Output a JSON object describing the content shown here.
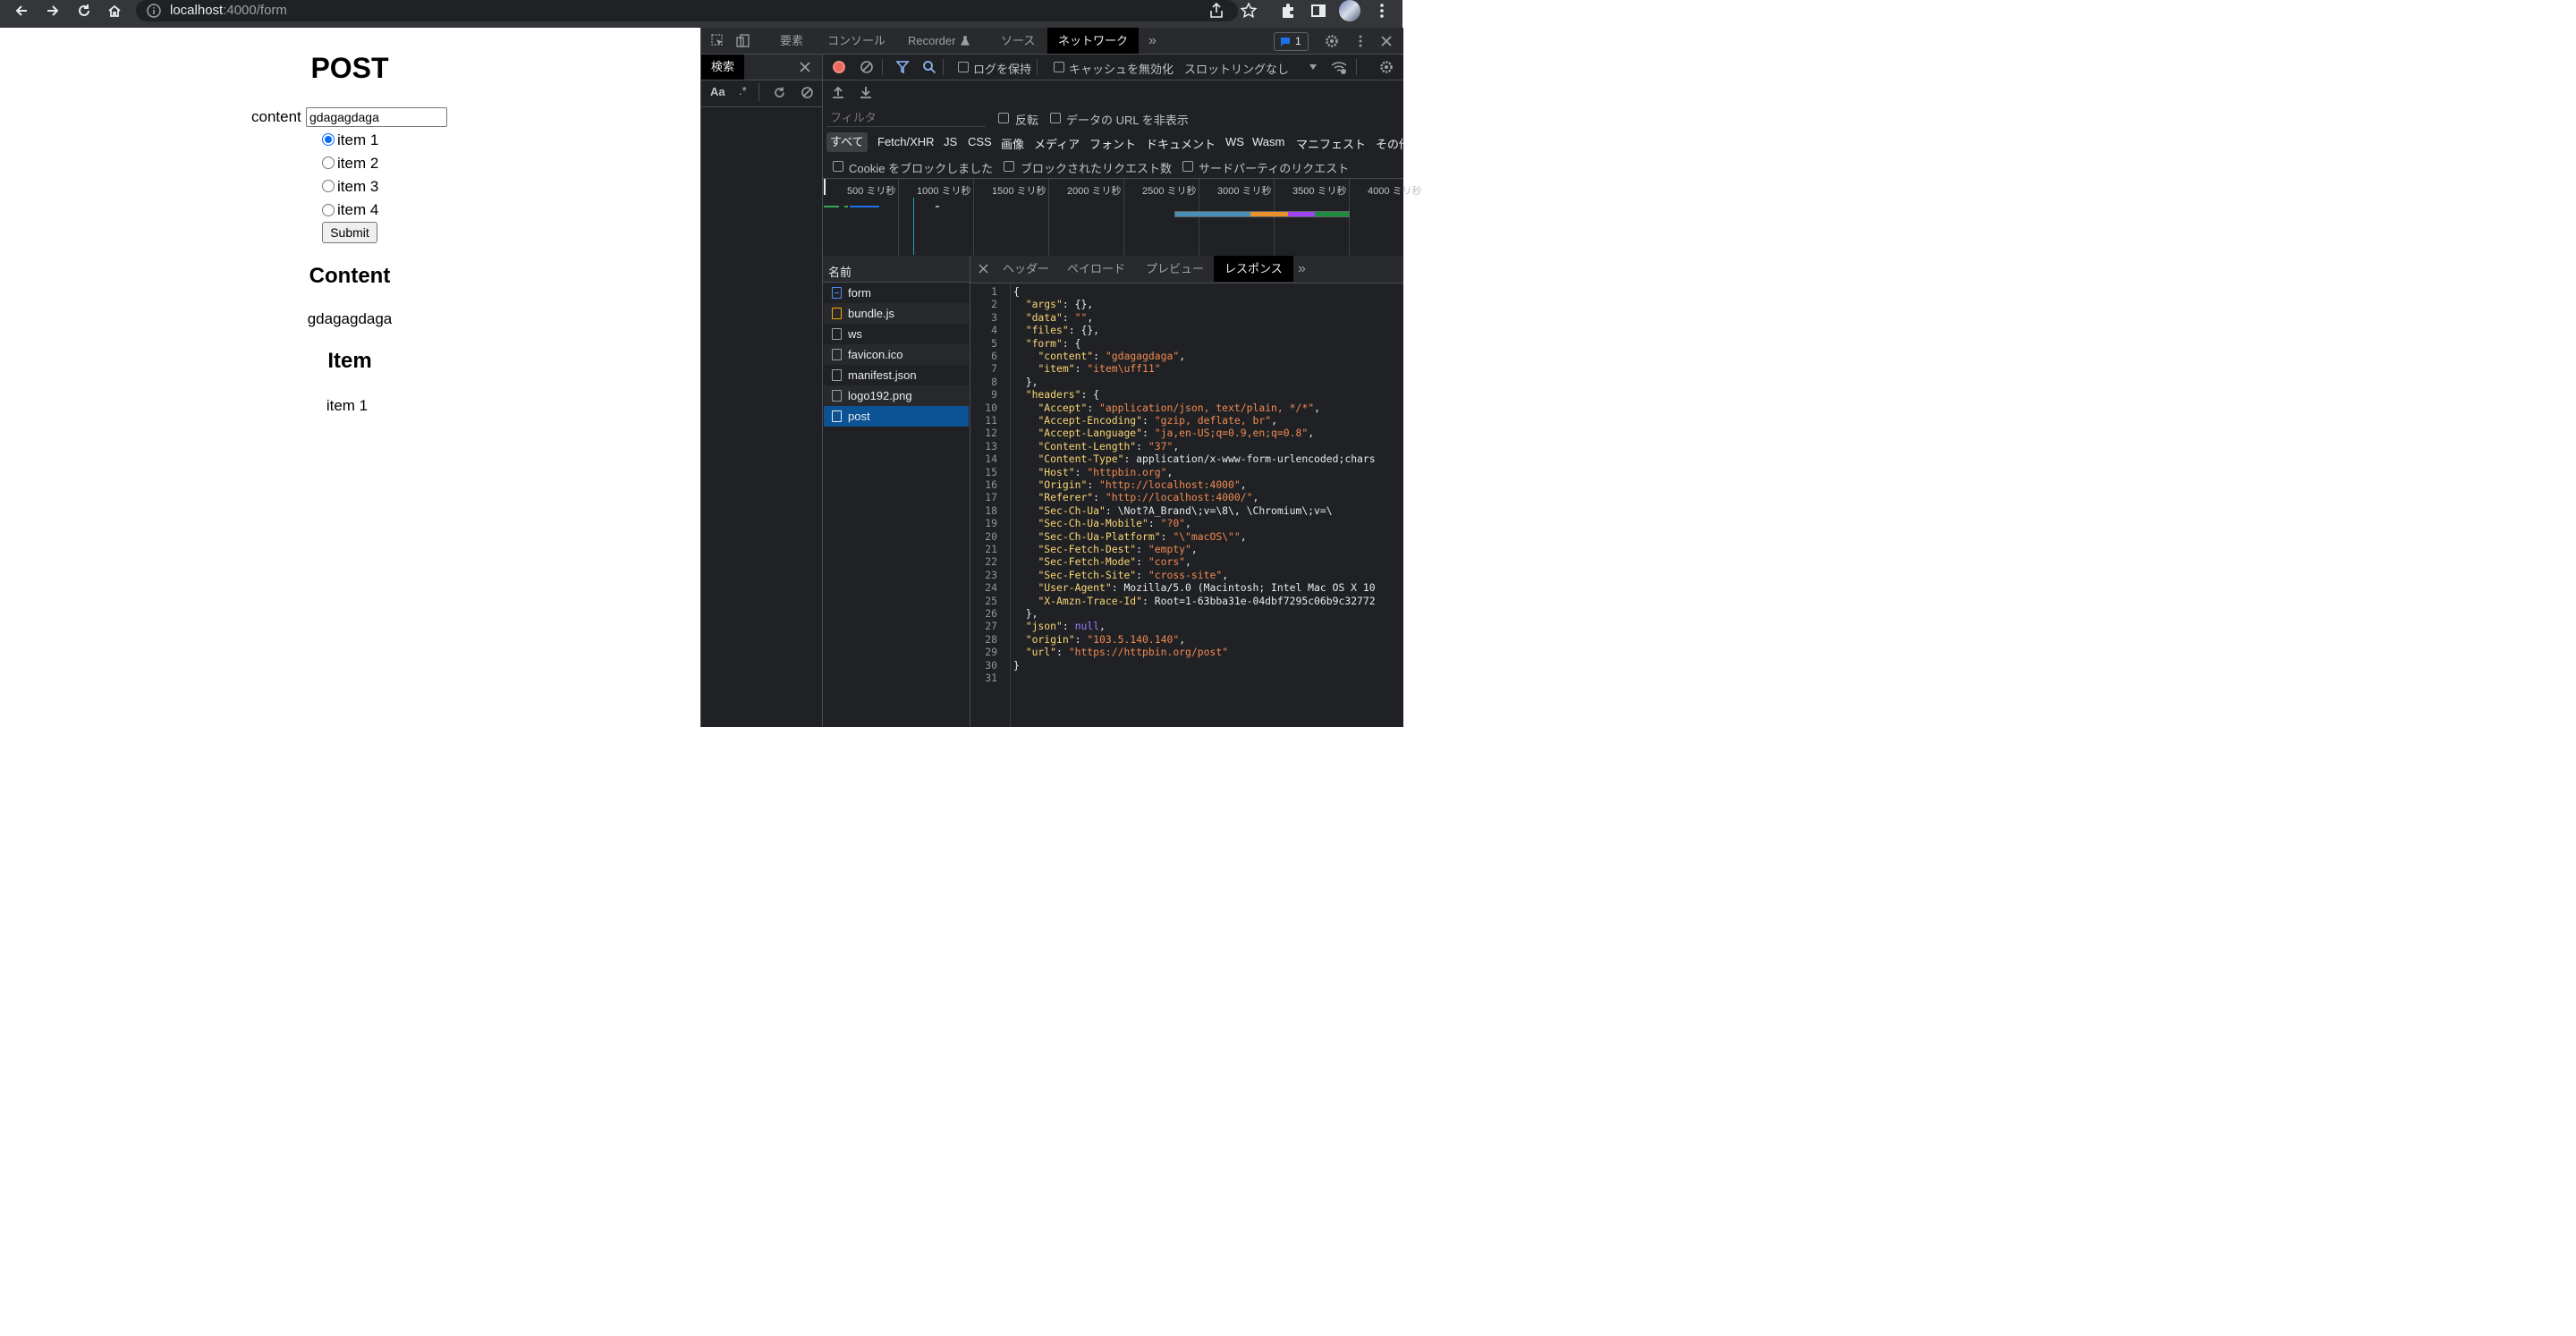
{
  "browser": {
    "url_host": "localhost",
    "url_path": ":4000/form"
  },
  "page": {
    "title": "POST",
    "content_label": "content",
    "content_value": "gdagagdaga",
    "radios": [
      {
        "label": "item 1",
        "checked": true
      },
      {
        "label": "item 2",
        "checked": false
      },
      {
        "label": "item 3",
        "checked": false
      },
      {
        "label": "item 4",
        "checked": false
      }
    ],
    "submit_label": "Submit",
    "content_heading": "Content",
    "content_text": "gdagagdaga",
    "item_heading": "Item",
    "item_text": "item 1"
  },
  "devtools": {
    "tabs": [
      "要素",
      "コンソール",
      "Recorder",
      "ソース",
      "ネットワーク"
    ],
    "active_tab": "ネットワーク",
    "issues_count": "1",
    "search_tab": "検索",
    "search_opts": [
      "Aa",
      ".*"
    ],
    "preserve_log": "ログを保持",
    "disable_cache": "キャッシュを無効化",
    "throttling": "スロットリングなし",
    "filter_placeholder": "フィルタ",
    "invert": "反転",
    "hide_data_urls": "データの URL を非表示",
    "types": [
      "すべて",
      "Fetch/XHR",
      "JS",
      "CSS",
      "画像",
      "メディア",
      "フォント",
      "ドキュメント",
      "WS",
      "Wasm",
      "マニフェスト",
      "その他"
    ],
    "blocked_cookies": "Cookie をブロックしました",
    "blocked_requests": "ブロックされたリクエスト数",
    "third_party": "サードパーティのリクエスト",
    "timeline_ticks": [
      "500 ミリ秒",
      "1000 ミリ秒",
      "1500 ミリ秒",
      "2000 ミリ秒",
      "2500 ミリ秒",
      "3000 ミリ秒",
      "3500 ミリ秒",
      "4000 ミリ秒"
    ],
    "name_header": "名前",
    "requests": [
      "form",
      "bundle.js",
      "ws",
      "favicon.ico",
      "manifest.json",
      "logo192.png",
      "post"
    ],
    "selected_request": "post",
    "detail_tabs": [
      "ヘッダー",
      "ペイロード",
      "プレビュー",
      "レスポンス"
    ],
    "active_detail_tab": "レスポンス",
    "response_lines": [
      "{",
      "  \"args\": {},",
      "  \"data\": \"\",",
      "  \"files\": {},",
      "  \"form\": {",
      "    \"content\": \"gdagagdaga\",",
      "    \"item\": \"item\\uff11\"",
      "  },",
      "  \"headers\": {",
      "    \"Accept\": \"application/json, text/plain, */*\",",
      "    \"Accept-Encoding\": \"gzip, deflate, br\",",
      "    \"Accept-Language\": \"ja,en-US;q=0.9,en;q=0.8\",",
      "    \"Content-Length\": \"37\",",
      "    \"Content-Type\": \"application/x-www-form-urlencoded;chars",
      "    \"Host\": \"httpbin.org\",",
      "    \"Origin\": \"http://localhost:4000\",",
      "    \"Referer\": \"http://localhost:4000/\",",
      "    \"Sec-Ch-Ua\": \"\\\"Not?A_Brand\\\";v=\\\"8\\\", \\\"Chromium\\\";v=\\\"",
      "    \"Sec-Ch-Ua-Mobile\": \"?0\",",
      "    \"Sec-Ch-Ua-Platform\": \"\\\"macOS\\\"\",",
      "    \"Sec-Fetch-Dest\": \"empty\",",
      "    \"Sec-Fetch-Mode\": \"cors\",",
      "    \"Sec-Fetch-Site\": \"cross-site\",",
      "    \"User-Agent\": \"Mozilla/5.0 (Macintosh; Intel Mac OS X 10",
      "    \"X-Amzn-Trace-Id\": \"Root=1-63bba31e-04dbf7295c06b9c32772",
      "  },",
      "  \"json\": null,",
      "  \"origin\": \"103.5.140.140\",",
      "  \"url\": \"https://httpbin.org/post\"",
      "}",
      ""
    ]
  }
}
